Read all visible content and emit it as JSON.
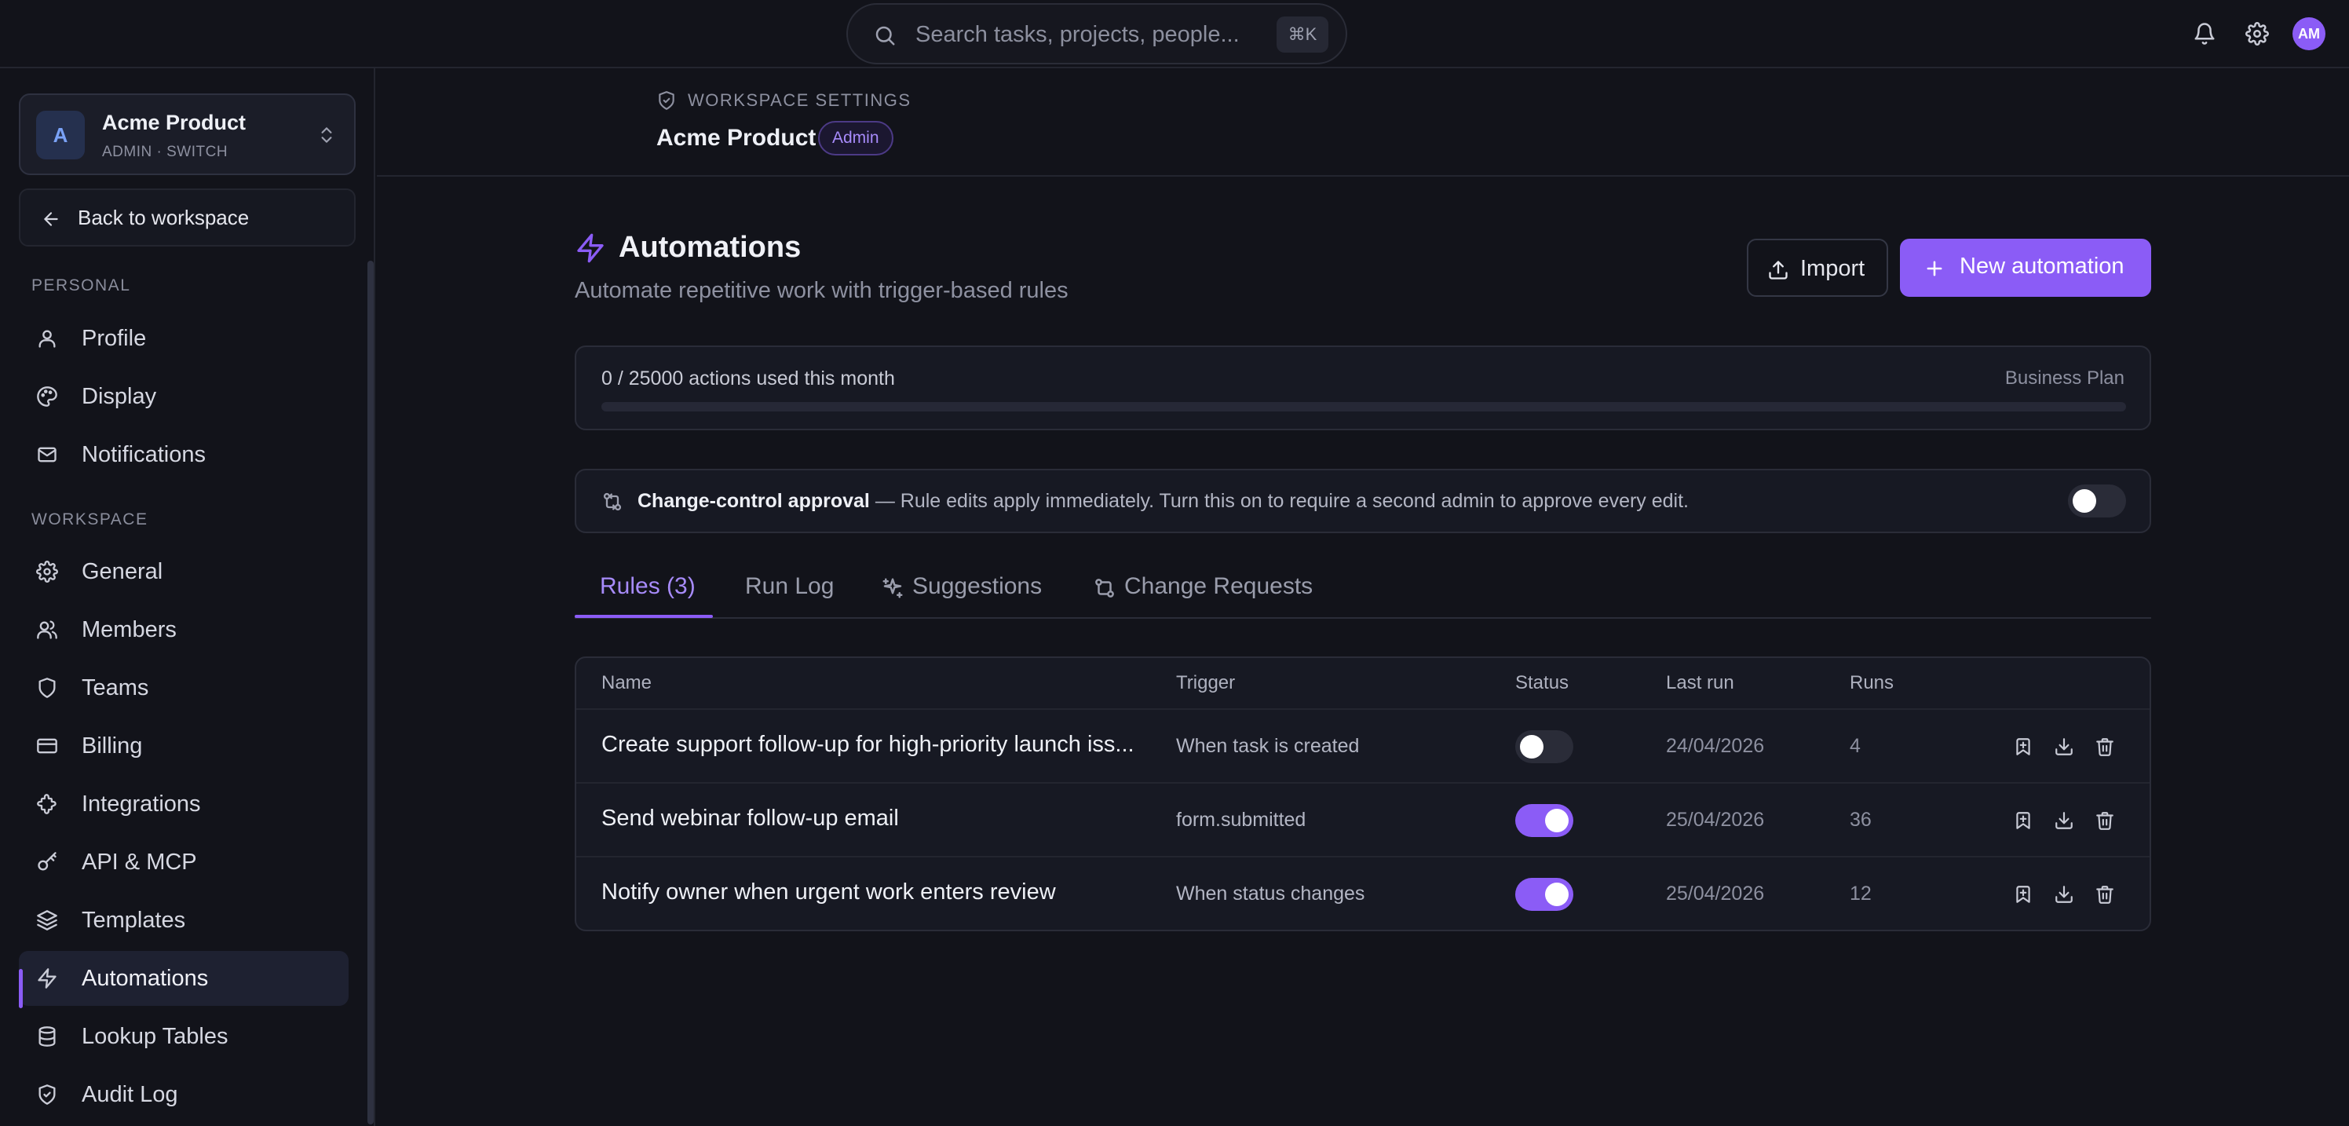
{
  "search": {
    "placeholder": "Search tasks, projects, people...",
    "shortcut": "⌘K"
  },
  "topbar": {
    "avatar_initials": "AM"
  },
  "workspace_switcher": {
    "avatar_letter": "A",
    "name": "Acme Product",
    "sub": "ADMIN · SWITCH"
  },
  "sidebar": {
    "back_label": "Back to workspace",
    "personal_label": "PERSONAL",
    "personal_items": [
      {
        "label": "Profile",
        "icon": "user-icon"
      },
      {
        "label": "Display",
        "icon": "palette-icon"
      },
      {
        "label": "Notifications",
        "icon": "mail-icon"
      }
    ],
    "workspace_label": "WORKSPACE",
    "workspace_items": [
      {
        "label": "General",
        "icon": "gear-icon"
      },
      {
        "label": "Members",
        "icon": "users-icon"
      },
      {
        "label": "Teams",
        "icon": "shield-icon"
      },
      {
        "label": "Billing",
        "icon": "credit-card-icon"
      },
      {
        "label": "Integrations",
        "icon": "puzzle-icon"
      },
      {
        "label": "API & MCP",
        "icon": "key-icon"
      },
      {
        "label": "Templates",
        "icon": "layers-icon"
      },
      {
        "label": "Automations",
        "icon": "bolt-icon",
        "active": true
      },
      {
        "label": "Lookup Tables",
        "icon": "database-icon"
      },
      {
        "label": "Audit Log",
        "icon": "shield-check-icon"
      }
    ]
  },
  "header": {
    "breadcrumb": "WORKSPACE SETTINGS",
    "title": "Acme Product",
    "badge": "Admin"
  },
  "page": {
    "title": "Automations",
    "subtitle": "Automate repetitive work with trigger-based rules",
    "import_label": "Import",
    "new_label": "New automation"
  },
  "usage": {
    "text": "0 / 25000 actions used this month",
    "plan": "Business Plan",
    "used": 0,
    "limit": 25000
  },
  "approval": {
    "title": "Change-control approval",
    "text": " — Rule edits apply immediately. Turn this on to require a second admin to approve every edit.",
    "enabled": false
  },
  "tabs": [
    {
      "label": "Rules (3)",
      "active": true
    },
    {
      "label": "Run Log"
    },
    {
      "label": "Suggestions",
      "icon": "sparkles-icon"
    },
    {
      "label": "Change Requests",
      "icon": "git-compare-icon"
    }
  ],
  "table": {
    "columns": [
      "Name",
      "Trigger",
      "Status",
      "Last run",
      "Runs"
    ],
    "rows": [
      {
        "name": "Create support follow-up for high-priority launch iss...",
        "trigger": "When task is created",
        "enabled": false,
        "last_run": "24/04/2026",
        "runs": "4"
      },
      {
        "name": "Send webinar follow-up email",
        "trigger": "form.submitted",
        "enabled": true,
        "last_run": "25/04/2026",
        "runs": "36"
      },
      {
        "name": "Notify owner when urgent work enters review",
        "trigger": "When status changes",
        "enabled": true,
        "last_run": "25/04/2026",
        "runs": "12"
      }
    ]
  },
  "colors": {
    "accent": "#8b5cf6",
    "background": "#12131a",
    "card": "#171923"
  }
}
